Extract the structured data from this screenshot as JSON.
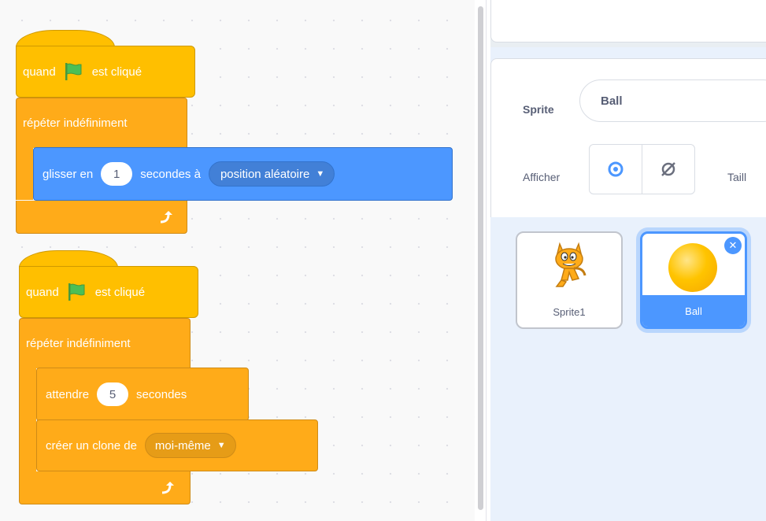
{
  "script1": {
    "hat": {
      "when": "quand",
      "clicked": "est cliqué"
    },
    "forever": {
      "label": "répéter indéfiniment"
    },
    "glide": {
      "label": "glisser en",
      "seconds_value": "1",
      "seconds_label": "secondes à",
      "target": "position aléatoire"
    }
  },
  "script2": {
    "hat": {
      "when": "quand",
      "clicked": "est cliqué"
    },
    "forever": {
      "label": "répéter indéfiniment"
    },
    "wait": {
      "label": "attendre",
      "value": "5",
      "unit": "secondes"
    },
    "clone": {
      "label": "créer un clone de",
      "target": "moi-même"
    }
  },
  "sprite_info": {
    "sprite_label": "Sprite",
    "sprite_name": "Ball",
    "show_label": "Afficher",
    "size_label_partial": "Taill"
  },
  "sprites": [
    {
      "name": "Sprite1",
      "selected": false
    },
    {
      "name": "Ball",
      "selected": true
    }
  ],
  "colors": {
    "events": "#ffbf00",
    "control": "#ffab19",
    "motion": "#4c97ff",
    "selected": "#4c97ff",
    "flag": "#4cbf56"
  }
}
